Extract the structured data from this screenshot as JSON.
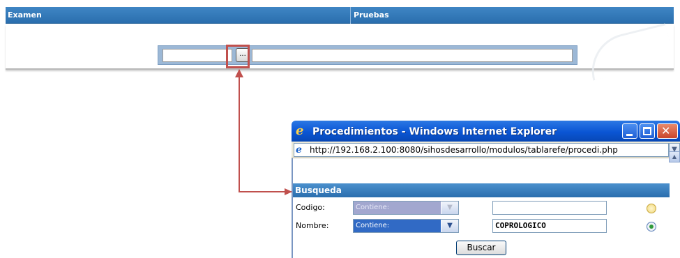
{
  "form": {
    "headers": [
      "Examen",
      "Pruebas"
    ],
    "lookup_button_label": "..."
  },
  "popup": {
    "title": "Procedimientos - Windows Internet Explorer",
    "address_url": "http://192.168.2.100:8080/sihosdesarrollo/modulos/tablarefe/procedi.php",
    "section_title": "Busqueda",
    "rows": [
      {
        "label": "Codigo:",
        "operator": "Contiene:",
        "value": ""
      },
      {
        "label": "Nombre:",
        "operator": "Contiene:",
        "value": "COPROLOGICO"
      }
    ],
    "search_button_label": "Buscar"
  },
  "colors": {
    "header_blue": "#2a6eae",
    "highlight_red": "#c0504d",
    "titlebar_blue": "#0a55d4"
  },
  "icons": [
    "ie-logo-icon",
    "page-icon",
    "minimize-icon",
    "maximize-icon",
    "close-icon",
    "dropdown-arrow-icon",
    "scroll-up-icon",
    "arrow-icon"
  ]
}
